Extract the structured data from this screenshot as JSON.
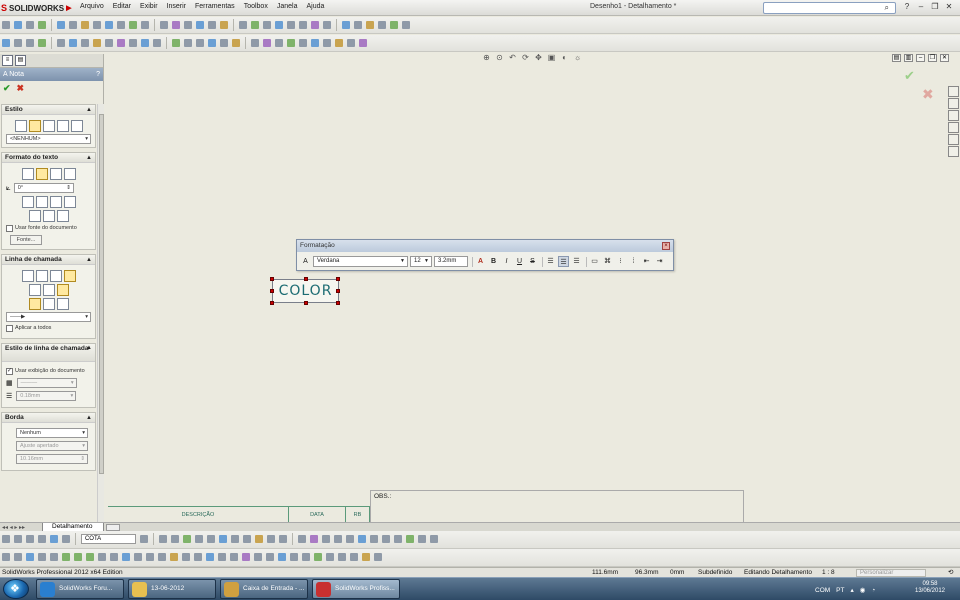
{
  "app": {
    "logo_text": "SOLIDWORKS",
    "menus": [
      "Arquivo",
      "Editar",
      "Exibir",
      "Inserir",
      "Ferramentas",
      "Toolbox",
      "Janela",
      "Ajuda"
    ],
    "document_title": "Desenho1 - Detalhamento *",
    "search_placeholder": ""
  },
  "property_manager": {
    "title": "Nota",
    "help": "?",
    "style": {
      "header": "Estilo",
      "select": "<NENHUM>"
    },
    "text_format": {
      "header": "Formato do texto",
      "angle": "0°",
      "use_doc_font": "Usar fonte do documento",
      "font_button": "Fonte..."
    },
    "leader": {
      "header": "Linha de chamada",
      "apply_all": "Aplicar a todos"
    },
    "leader_style": {
      "header": "Estilo de linha de chamada",
      "use_doc_display": "Usar exibição do documento",
      "thickness": "0.18mm"
    },
    "border": {
      "header": "Borda",
      "type": "Nenhum",
      "size": "Ajuste apertado",
      "value": "10.16mm"
    }
  },
  "formatting_toolbar": {
    "title": "Formatação",
    "font": "Verdana",
    "size": "12",
    "height": "3.2mm",
    "bold": "B",
    "italic": "I",
    "underline": "U",
    "strike": "S"
  },
  "note": {
    "text": "COLOR"
  },
  "title_block": {
    "obs": "OBS.:",
    "col1": "DESCRIÇÃO",
    "col2": "DATA",
    "col3": "RB"
  },
  "sheet_tab": {
    "label": "Detalhamento"
  },
  "command_select": "COTA",
  "statusbar": {
    "product": "SolidWorks Professional 2012 x64 Edition",
    "x": "111.6mm",
    "y": "96.3mm",
    "z": "0mm",
    "state": "Subdefinido",
    "mode": "Editando Detalhamento",
    "scale": "1 : 8",
    "custom": "Personalizar"
  },
  "taskbar": {
    "tasks": [
      {
        "label": "SolidWorks Foru...",
        "color": "#2a7fd0"
      },
      {
        "label": "13-06-2012",
        "color": "#e8c050"
      },
      {
        "label": "Caixa de Entrada - ...",
        "color": "#d0a040"
      },
      {
        "label": "SolidWorks Profiss...",
        "color": "#c83030"
      }
    ],
    "tray_lang": "COM",
    "tray_loc": "PT",
    "time": "09:58",
    "date": "13/06/2012"
  }
}
